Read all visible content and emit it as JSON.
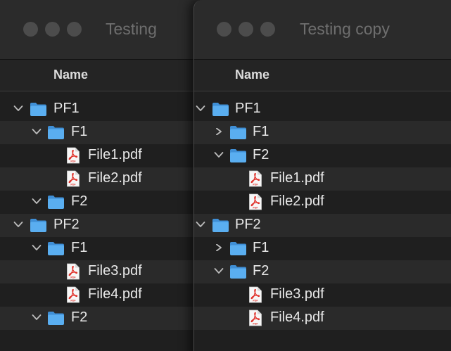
{
  "colors": {
    "folder": "#5aaef0",
    "folder_tab": "#3f8fd6",
    "pdf_red": "#e0322b",
    "text": "#e8e8e8",
    "title_dim": "#6e6e6e"
  },
  "windows": [
    {
      "title": "Testing",
      "column_name": "Name",
      "rows": [
        {
          "label": "PF1",
          "kind": "folder",
          "level": 0,
          "expanded": true
        },
        {
          "label": "F1",
          "kind": "folder",
          "level": 1,
          "expanded": true
        },
        {
          "label": "File1.pdf",
          "kind": "pdf",
          "level": 2
        },
        {
          "label": "File2.pdf",
          "kind": "pdf",
          "level": 2
        },
        {
          "label": "F2",
          "kind": "folder",
          "level": 1,
          "expanded": true
        },
        {
          "label": "PF2",
          "kind": "folder",
          "level": 0,
          "expanded": true
        },
        {
          "label": "F1",
          "kind": "folder",
          "level": 1,
          "expanded": true
        },
        {
          "label": "File3.pdf",
          "kind": "pdf",
          "level": 2
        },
        {
          "label": "File4.pdf",
          "kind": "pdf",
          "level": 2
        },
        {
          "label": "F2",
          "kind": "folder",
          "level": 1,
          "expanded": true
        }
      ]
    },
    {
      "title": "Testing copy",
      "column_name": "Name",
      "rows": [
        {
          "label": "PF1",
          "kind": "folder",
          "level": 0,
          "expanded": true
        },
        {
          "label": "F1",
          "kind": "folder",
          "level": 1,
          "expanded": false
        },
        {
          "label": "F2",
          "kind": "folder",
          "level": 1,
          "expanded": true
        },
        {
          "label": "File1.pdf",
          "kind": "pdf",
          "level": 2
        },
        {
          "label": "File2.pdf",
          "kind": "pdf",
          "level": 2
        },
        {
          "label": "PF2",
          "kind": "folder",
          "level": 0,
          "expanded": true
        },
        {
          "label": "F1",
          "kind": "folder",
          "level": 1,
          "expanded": false
        },
        {
          "label": "F2",
          "kind": "folder",
          "level": 1,
          "expanded": true
        },
        {
          "label": "File3.pdf",
          "kind": "pdf",
          "level": 2
        },
        {
          "label": "File4.pdf",
          "kind": "pdf",
          "level": 2
        }
      ]
    }
  ]
}
